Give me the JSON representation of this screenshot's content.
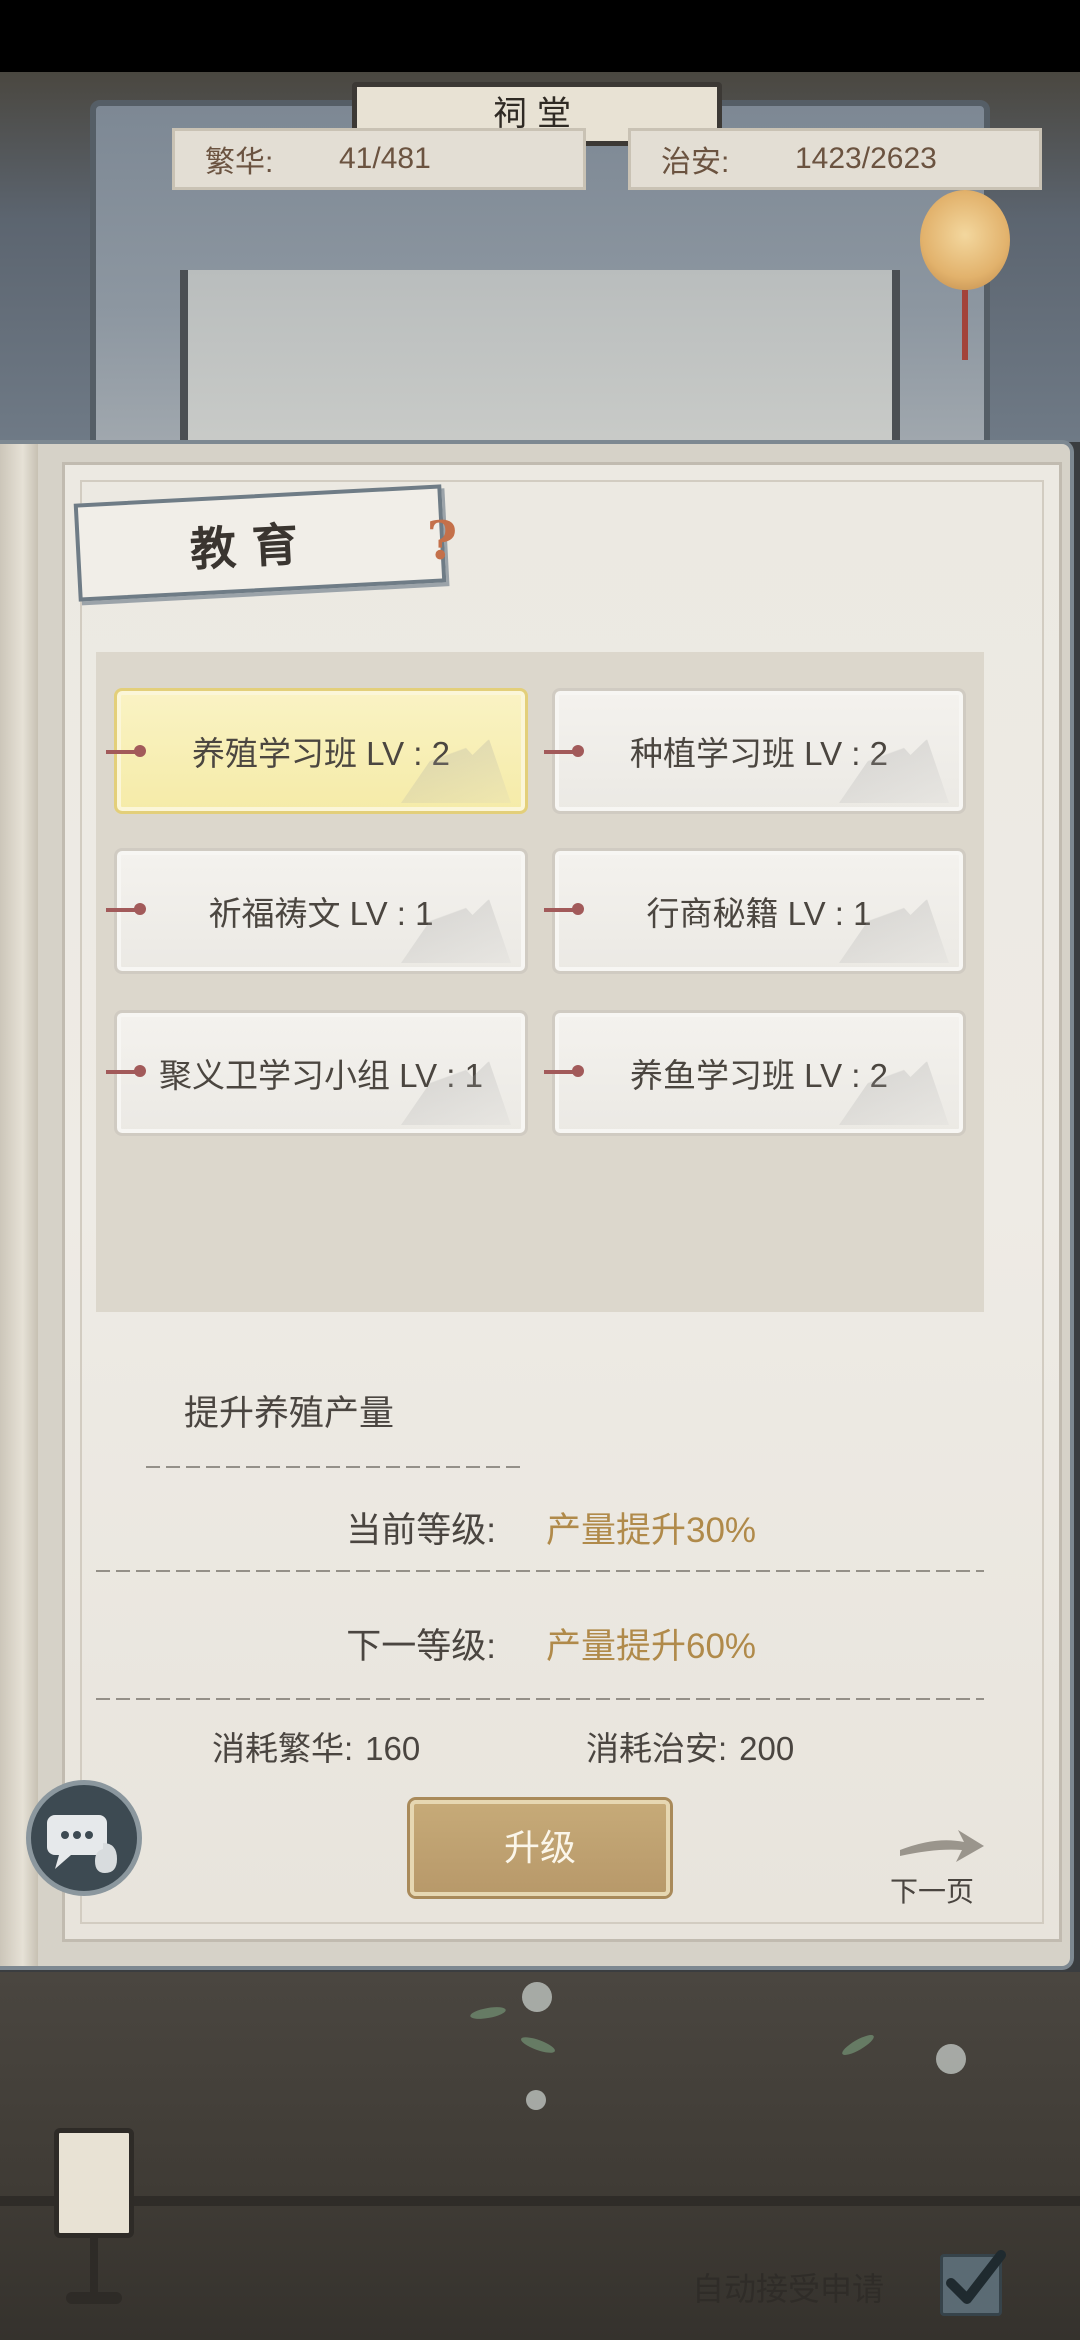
{
  "top_bar": {
    "prosperity": {
      "label": "繁华:",
      "value": "41/481"
    },
    "security": {
      "label": "治安:",
      "value": "1423/2623"
    },
    "building_plaque": "祠堂"
  },
  "panel": {
    "title": "教育",
    "help_icon": "?",
    "skills": [
      {
        "name": "养殖学习班 LV : 2",
        "selected": true
      },
      {
        "name": "种植学习班 LV : 2",
        "selected": false
      },
      {
        "name": "祈福祷文 LV : 1",
        "selected": false
      },
      {
        "name": "行商秘籍 LV : 1",
        "selected": false
      },
      {
        "name": "聚义卫学习小组 LV : 1",
        "selected": false
      },
      {
        "name": "养鱼学习班 LV : 2",
        "selected": false
      }
    ],
    "description": "提升养殖产量",
    "current_level": {
      "label": "当前等级:",
      "value": "产量提升30%"
    },
    "next_level": {
      "label": "下一等级:",
      "value": "产量提升60%"
    },
    "cost_prosperity": {
      "label": "消耗繁华:",
      "value": "160"
    },
    "cost_security": {
      "label": "消耗治安:",
      "value": "200"
    },
    "upgrade_button": "升级",
    "next_page": "下一页"
  },
  "bottom": {
    "auto_accept_label": "自动接受申请",
    "auto_accept_checked": true
  },
  "icons": {
    "chat": "chat-bubble-icon",
    "help": "question-mark-icon",
    "next": "arrow-right-icon",
    "check": "check-icon",
    "lamp": "moon-lantern-icon"
  },
  "colors": {
    "value_gold": "#b08a4a",
    "selected_card": "#f5eba8",
    "button_gold": "#b8996a"
  }
}
